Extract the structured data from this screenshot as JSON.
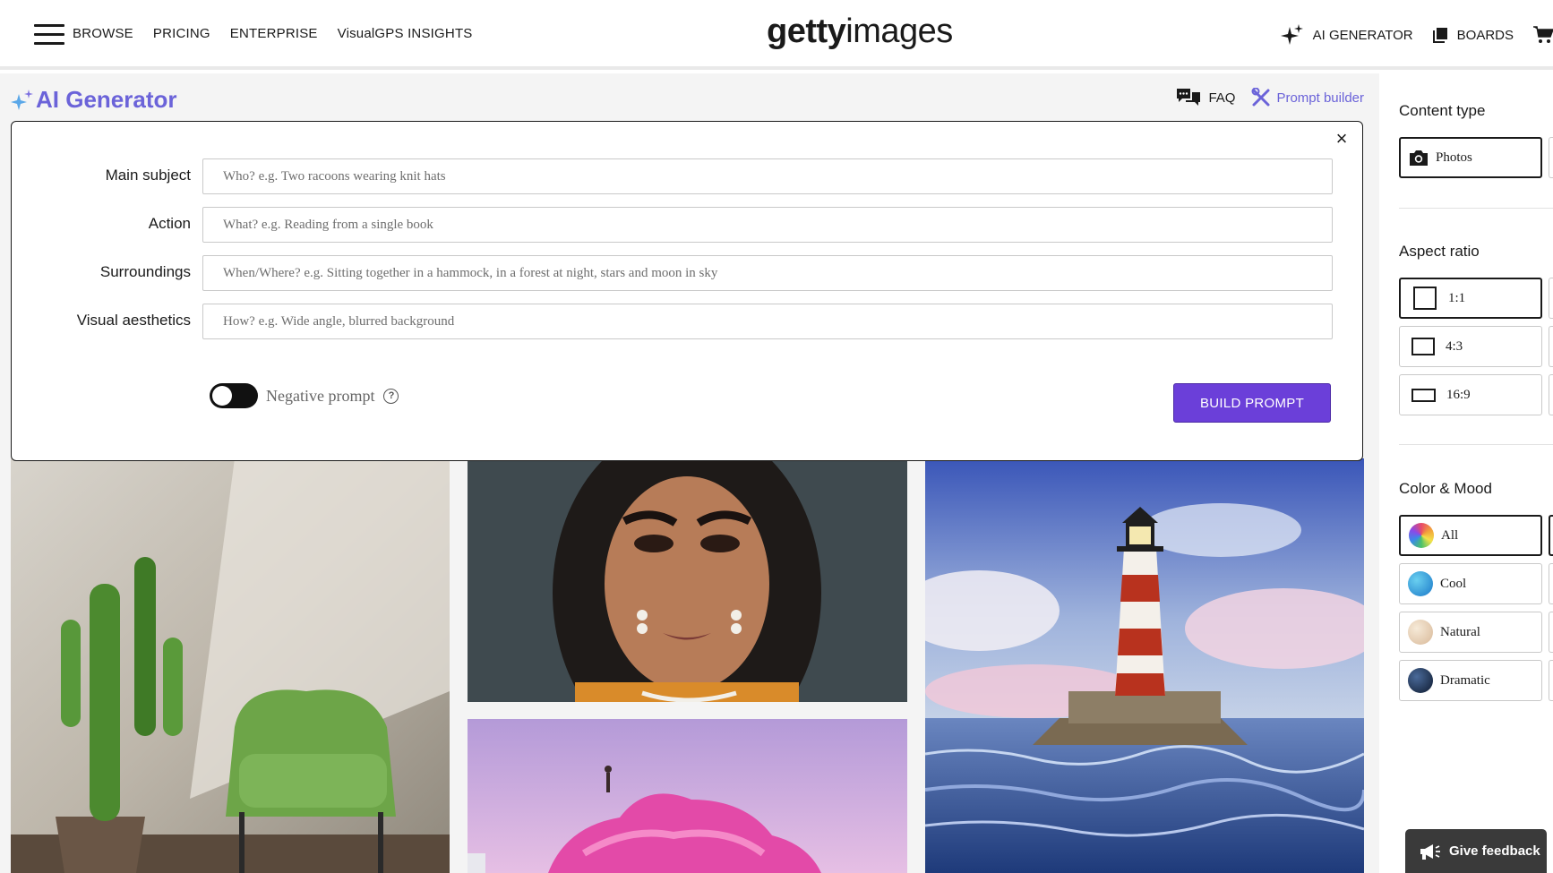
{
  "nav": {
    "links": [
      "BROWSE",
      "PRICING",
      "ENTERPRISE",
      "VisualGPS INSIGHTS"
    ],
    "logo_bold": "getty",
    "logo_light": "images",
    "ai_generator": "AI GENERATOR",
    "boards": "BOARDS"
  },
  "page": {
    "title": "AI Generator",
    "faq": "FAQ",
    "prompt_builder": "Prompt builder"
  },
  "builder": {
    "fields": [
      {
        "label": "Main subject",
        "placeholder": "Who? e.g. Two racoons wearing knit hats"
      },
      {
        "label": "Action",
        "placeholder": "What? e.g. Reading from a single book"
      },
      {
        "label": "Surroundings",
        "placeholder": "When/Where? e.g. Sitting together in a hammock, in a forest at night, stars and moon in sky"
      },
      {
        "label": "Visual aesthetics",
        "placeholder": "How? e.g. Wide angle, blurred background"
      }
    ],
    "negative_prompt": "Negative prompt",
    "help_glyph": "?",
    "build_button": "BUILD PROMPT",
    "close_glyph": "×"
  },
  "sidebar": {
    "content_type": {
      "title": "Content type",
      "options": [
        "Photos"
      ]
    },
    "aspect_ratio": {
      "title": "Aspect ratio",
      "options": [
        "1:1",
        "4:3",
        "16:9"
      ]
    },
    "color_mood": {
      "title": "Color & Mood",
      "options": [
        "All",
        "Cool",
        "Natural",
        "Dramatic"
      ]
    }
  },
  "feedback": "Give feedback",
  "colors": {
    "accent": "#6b3fd9",
    "accent_text": "#6b63d9"
  }
}
